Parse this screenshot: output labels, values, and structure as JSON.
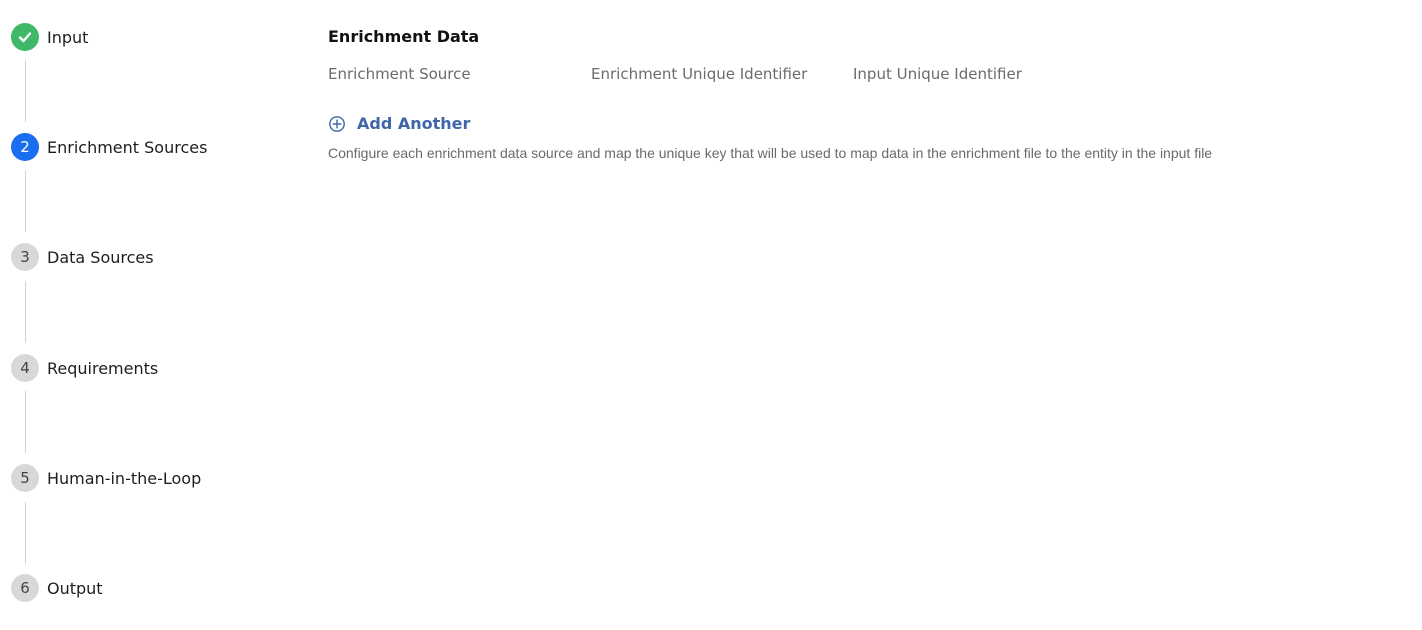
{
  "stepper": {
    "steps": [
      {
        "number": "",
        "label": "Input",
        "state": "done",
        "icon": "check-icon"
      },
      {
        "number": "2",
        "label": "Enrichment Sources",
        "state": "active"
      },
      {
        "number": "3",
        "label": "Data Sources",
        "state": "pending"
      },
      {
        "number": "4",
        "label": "Requirements",
        "state": "pending"
      },
      {
        "number": "5",
        "label": "Human-in-the-Loop",
        "state": "pending"
      },
      {
        "number": "6",
        "label": "Output",
        "state": "pending"
      }
    ],
    "colors": {
      "done": "#3fb86a",
      "active": "#1a6ef0",
      "pending": "#d8d8d8"
    }
  },
  "main": {
    "title": "Enrichment Data",
    "columns": [
      "Enrichment Source",
      "Enrichment Unique Identifier",
      "Input Unique Identifier"
    ],
    "add_another": {
      "label": "Add Another",
      "icon": "plus-circle-icon",
      "color": "#3f67a8"
    },
    "hint": "Configure each enrichment data source and map the unique key that will be used to map data in the enrichment file to the entity in the input file"
  }
}
